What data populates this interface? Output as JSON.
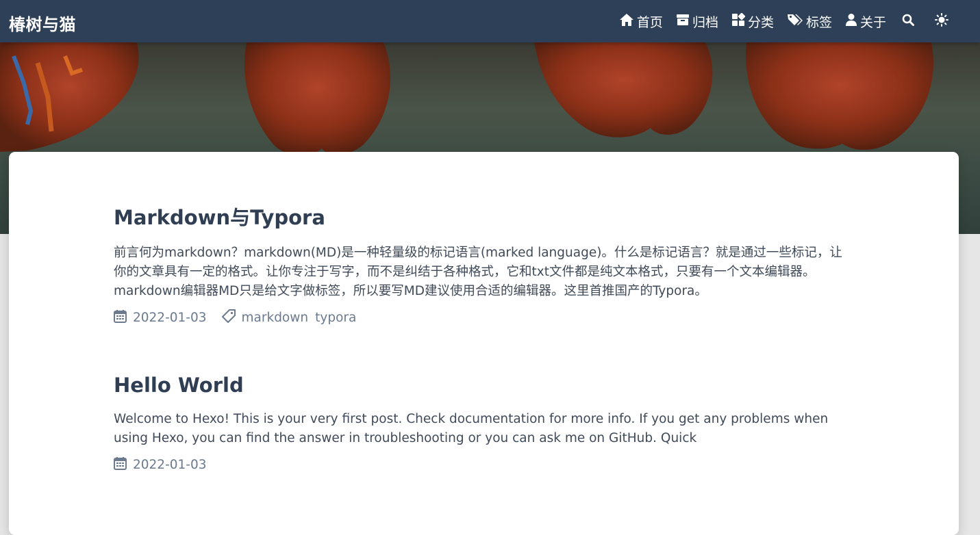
{
  "nav": {
    "brand": "椿树与猫",
    "items": [
      {
        "label": "首页",
        "icon": "home-icon"
      },
      {
        "label": "归档",
        "icon": "archive-icon"
      },
      {
        "label": "分类",
        "icon": "categories-icon"
      },
      {
        "label": "标签",
        "icon": "tags-icon"
      },
      {
        "label": "关于",
        "icon": "user-icon"
      }
    ],
    "search_icon": "search-icon",
    "theme_icon": "sun-icon"
  },
  "colors": {
    "navbar": "#2e4057",
    "title": "#2f3e52",
    "text": "#404a58",
    "meta": "#6b7a8f"
  },
  "posts": [
    {
      "title": "Markdown与Typora",
      "excerpt": "前言何为markdown？markdown(MD)是一种轻量级的标记语言(marked language)。什么是标记语言？就是通过一些标记，让你的文章具有一定的格式。让你专注于写字，而不是纠结于各种格式，它和txt文件都是纯文本格式，只要有一个文本编辑器。 markdown编辑器MD只是给文字做标签，所以要写MD建议使用合适的编辑器。这里首推国产的Typora。",
      "date": "2022-01-03",
      "tags": [
        "markdown",
        "typora"
      ]
    },
    {
      "title": "Hello World",
      "excerpt": "Welcome to Hexo! This is your very first post. Check documentation for more info. If you get any problems when using Hexo, you can find the answer in troubleshooting or you can ask me on GitHub. Quick",
      "date": "2022-01-03",
      "tags": []
    }
  ]
}
